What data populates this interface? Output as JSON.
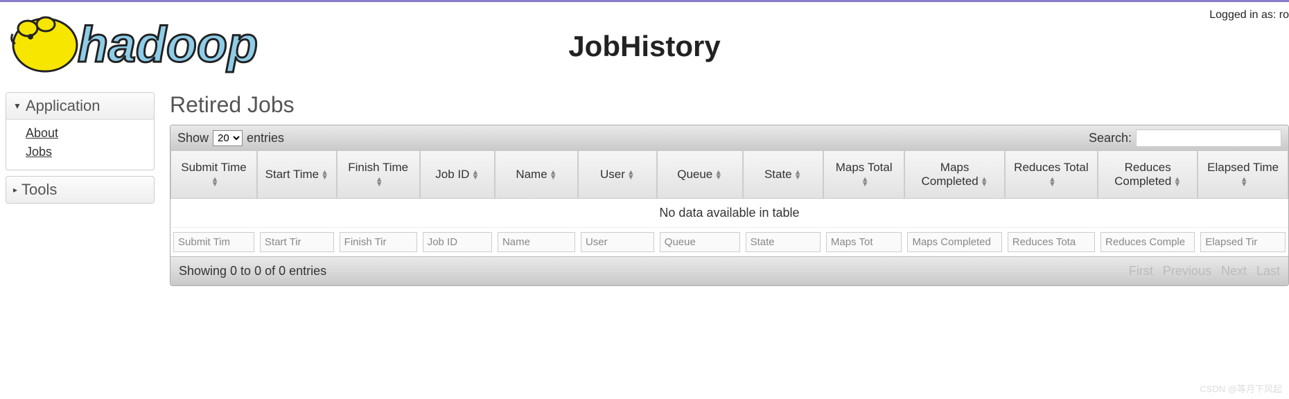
{
  "header": {
    "page_title": "JobHistory",
    "login_text": "Logged in as: ro",
    "logo_text": "hadoop"
  },
  "sidebar": {
    "sections": [
      {
        "title": "Application",
        "expanded": true,
        "links": [
          "About",
          "Jobs"
        ]
      },
      {
        "title": "Tools",
        "expanded": false,
        "links": []
      }
    ]
  },
  "content": {
    "section_title": "Retired Jobs",
    "toolbar": {
      "show_label": "Show",
      "entries_label": "entries",
      "entries_value": "20",
      "search_label": "Search:"
    },
    "columns": [
      "Submit Time",
      "Start Time",
      "Finish Time",
      "Job ID",
      "Name",
      "User",
      "Queue",
      "State",
      "Maps Total",
      "Maps Completed",
      "Reduces Total",
      "Reduces Completed",
      "Elapsed Time"
    ],
    "filter_placeholders": [
      "Submit Tim",
      "Start Tir",
      "Finish Tir",
      "Job ID",
      "Name",
      "User",
      "Queue",
      "State",
      "Maps Tot",
      "Maps Completed",
      "Reduces Tota",
      "Reduces Comple",
      "Elapsed Tir"
    ],
    "empty_message": "No data available in table",
    "footer": {
      "info": "Showing 0 to 0 of 0 entries",
      "pager": {
        "first": "First",
        "previous": "Previous",
        "next": "Next",
        "last": "Last"
      }
    }
  },
  "watermark": "CSDN @等月下风起"
}
